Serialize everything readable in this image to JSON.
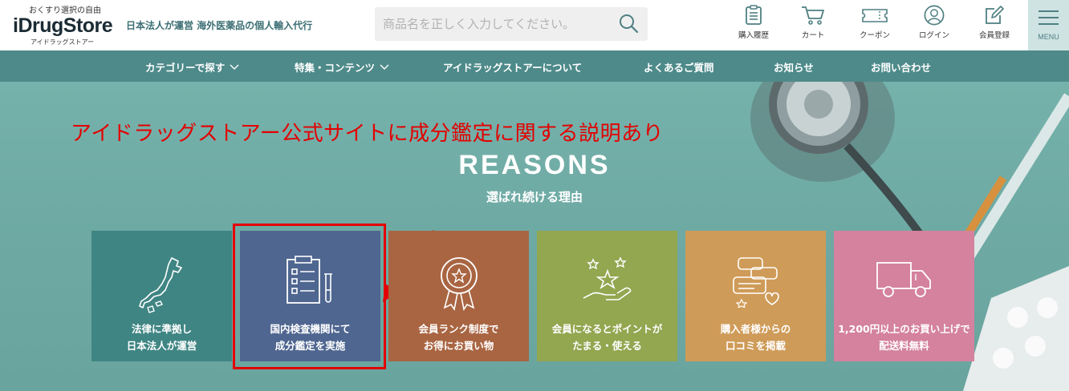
{
  "header": {
    "logo_tagline": "おくすり選択の自由",
    "logo_main": "iDrugStore",
    "logo_sub": "アイドラッグストアー",
    "tagline": "日本法人が運営 海外医薬品の個人輸入代行",
    "search_placeholder": "商品名を正しく入力してください。",
    "icons": [
      {
        "label": "購入履歴",
        "icon": "clipboard-icon"
      },
      {
        "label": "カート",
        "icon": "cart-icon"
      },
      {
        "label": "クーポン",
        "icon": "coupon-icon"
      },
      {
        "label": "ログイン",
        "icon": "user-icon"
      },
      {
        "label": "会員登録",
        "icon": "edit-icon"
      }
    ],
    "menu_label": "MENU"
  },
  "nav": {
    "items": [
      {
        "label": "カテゴリーで探す"
      },
      {
        "label": "特集・コンテンツ"
      },
      {
        "label": "アイドラッグストアーについて"
      },
      {
        "label": "よくあるご質問"
      },
      {
        "label": "お知らせ"
      },
      {
        "label": "お問い合わせ"
      }
    ]
  },
  "hero": {
    "annotation": "アイドラッグストアー公式サイトに成分鑑定に関する説明あり",
    "title": "REASONS",
    "subtitle": "選ばれ続ける理由",
    "cards": [
      {
        "line1": "法律に準拠し",
        "line2": "日本法人が運営",
        "color": "#3f8583",
        "icon": "japan-map-icon"
      },
      {
        "line1": "国内検査機関にて",
        "line2": "成分鑑定を実施",
        "color": "#4f6690",
        "icon": "inspection-clipboard-icon"
      },
      {
        "line1": "会員ランク制度で",
        "line2": "お得にお買い物",
        "color": "#a96542",
        "icon": "rank-badge-icon"
      },
      {
        "line1": "会員になるとポイントが",
        "line2": "たまる・使える",
        "color": "#93a650",
        "icon": "points-hand-icon"
      },
      {
        "line1": "購入者様からの",
        "line2": "口コミを掲載",
        "color": "#cf9b58",
        "icon": "reviews-chat-icon"
      },
      {
        "line1": "1,200円以上のお買い上げで",
        "line2": "配送料無料",
        "color": "#d4829e",
        "icon": "delivery-truck-icon"
      }
    ]
  },
  "colors": {
    "nav_bg": "#4e8a8a",
    "annotation": "#e30000"
  }
}
